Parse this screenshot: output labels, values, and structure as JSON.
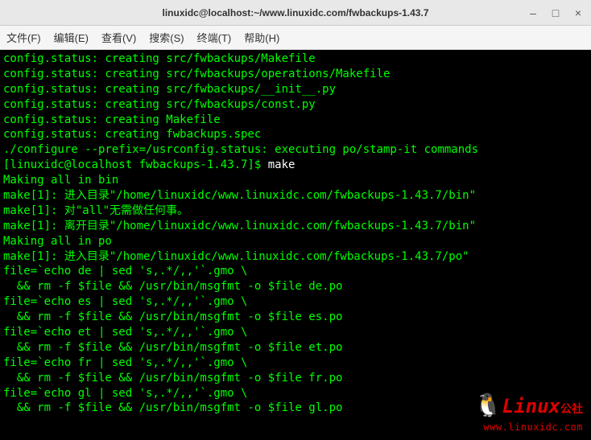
{
  "window": {
    "title": "linuxidc@localhost:~/www.linuxidc.com/fwbackups-1.43.7"
  },
  "menubar": {
    "file": "文件(F)",
    "edit": "编辑(E)",
    "view": "查看(V)",
    "search": "搜索(S)",
    "terminal": "终端(T)",
    "help": "帮助(H)"
  },
  "terminal": {
    "lines": [
      "config.status: creating src/fwbackups/Makefile",
      "config.status: creating src/fwbackups/operations/Makefile",
      "config.status: creating src/fwbackups/__init__.py",
      "config.status: creating src/fwbackups/const.py",
      "config.status: creating Makefile",
      "config.status: creating fwbackups.spec",
      "./configure --prefix=/usrconfig.status: executing po/stamp-it commands"
    ],
    "prompt": "[linuxidc@localhost fwbackups-1.43.7]$ ",
    "promptCmd": "make",
    "afterPrompt": [
      "Making all in bin",
      "make[1]: 进入目录\"/home/linuxidc/www.linuxidc.com/fwbackups-1.43.7/bin\"",
      "make[1]: 对\"all\"无需做任何事。",
      "make[1]: 离开目录\"/home/linuxidc/www.linuxidc.com/fwbackups-1.43.7/bin\"",
      "Making all in po",
      "make[1]: 进入目录\"/home/linuxidc/www.linuxidc.com/fwbackups-1.43.7/po\"",
      "file=`echo de | sed 's,.*/,,'`.gmo \\",
      "  && rm -f $file && /usr/bin/msgfmt -o $file de.po",
      "file=`echo es | sed 's,.*/,,'`.gmo \\",
      "  && rm -f $file && /usr/bin/msgfmt -o $file es.po",
      "file=`echo et | sed 's,.*/,,'`.gmo \\",
      "  && rm -f $file && /usr/bin/msgfmt -o $file et.po",
      "file=`echo fr | sed 's,.*/,,'`.gmo \\",
      "  && rm -f $file && /usr/bin/msgfmt -o $file fr.po",
      "file=`echo gl | sed 's,.*/,,'`.gmo \\",
      "  && rm -f $file && /usr/bin/msgfmt -o $file gl.po"
    ]
  },
  "watermark": {
    "tux": "🐧",
    "brand": "Linux",
    "suffix": "公社",
    "url": "www.linuxidc.com"
  }
}
